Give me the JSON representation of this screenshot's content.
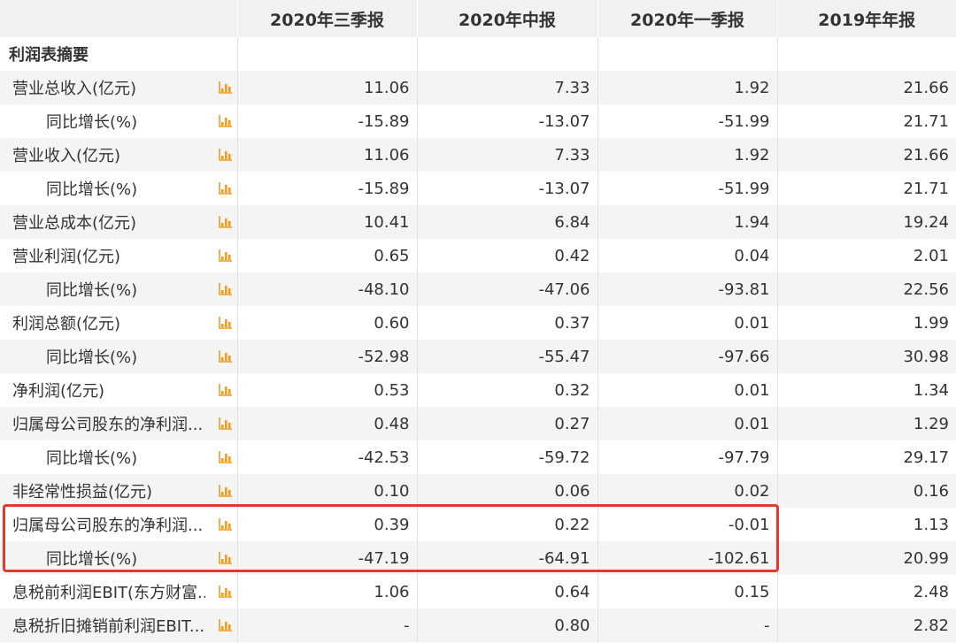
{
  "table": {
    "columns": [
      "",
      "2020年三季报",
      "2020年中报",
      "2020年一季报",
      "2019年年报"
    ],
    "section_title": "利润表摘要",
    "chart_icon": "bar-chart-icon",
    "icon_color": "#f29c1f",
    "highlight_color": "#e23a2e",
    "rows": [
      {
        "label": "营业总收入(亿元)",
        "level": 0,
        "values": [
          "11.06",
          "7.33",
          "1.92",
          "21.66"
        ]
      },
      {
        "label": "同比增长(%)",
        "level": 1,
        "values": [
          "-15.89",
          "-13.07",
          "-51.99",
          "21.71"
        ]
      },
      {
        "label": "营业收入(亿元)",
        "level": 0,
        "values": [
          "11.06",
          "7.33",
          "1.92",
          "21.66"
        ]
      },
      {
        "label": "同比增长(%)",
        "level": 1,
        "values": [
          "-15.89",
          "-13.07",
          "-51.99",
          "21.71"
        ]
      },
      {
        "label": "营业总成本(亿元)",
        "level": 0,
        "values": [
          "10.41",
          "6.84",
          "1.94",
          "19.24"
        ]
      },
      {
        "label": "营业利润(亿元)",
        "level": 0,
        "values": [
          "0.65",
          "0.42",
          "0.04",
          "2.01"
        ]
      },
      {
        "label": "同比增长(%)",
        "level": 1,
        "values": [
          "-48.10",
          "-47.06",
          "-93.81",
          "22.56"
        ]
      },
      {
        "label": "利润总额(亿元)",
        "level": 0,
        "values": [
          "0.60",
          "0.37",
          "0.01",
          "1.99"
        ]
      },
      {
        "label": "同比增长(%)",
        "level": 1,
        "values": [
          "-52.98",
          "-55.47",
          "-97.66",
          "30.98"
        ]
      },
      {
        "label": "净利润(亿元)",
        "level": 0,
        "values": [
          "0.53",
          "0.32",
          "0.01",
          "1.34"
        ]
      },
      {
        "label": "归属母公司股东的净利润...",
        "level": 0,
        "values": [
          "0.48",
          "0.27",
          "0.01",
          "1.29"
        ]
      },
      {
        "label": "同比增长(%)",
        "level": 1,
        "values": [
          "-42.53",
          "-59.72",
          "-97.79",
          "29.17"
        ]
      },
      {
        "label": "非经常性损益(亿元)",
        "level": 0,
        "values": [
          "0.10",
          "0.06",
          "0.02",
          "0.16"
        ]
      },
      {
        "label": "归属母公司股东的净利润...",
        "level": 0,
        "values": [
          "0.39",
          "0.22",
          "-0.01",
          "1.13"
        ]
      },
      {
        "label": "同比增长(%)",
        "level": 1,
        "values": [
          "-47.19",
          "-64.91",
          "-102.61",
          "20.99"
        ]
      },
      {
        "label": "息税前利润EBIT(东方财富...",
        "level": 0,
        "values": [
          "1.06",
          "0.64",
          "0.15",
          "2.48"
        ]
      },
      {
        "label": "息税折旧摊销前利润EBIT...",
        "level": 0,
        "values": [
          "-",
          "0.80",
          "-",
          "2.82"
        ]
      }
    ]
  }
}
